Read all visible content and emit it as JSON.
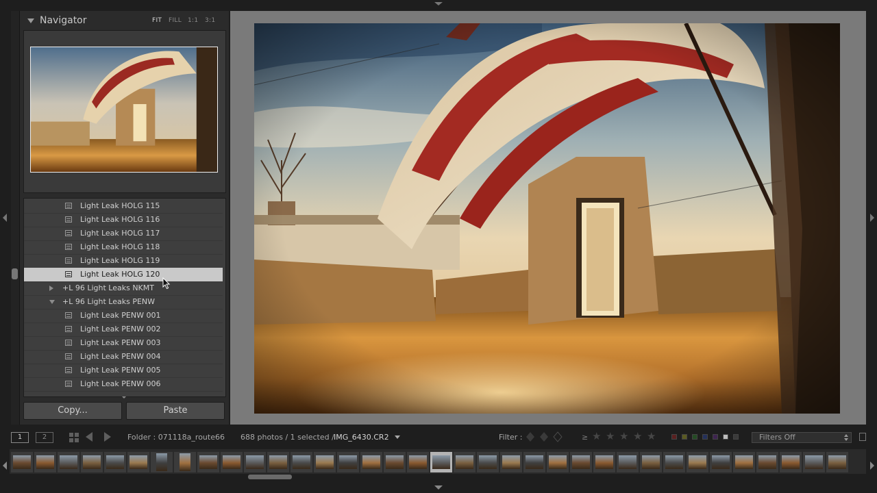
{
  "navigator": {
    "title": "Navigator",
    "zoom_options": [
      "FIT",
      "FILL",
      "1:1",
      "3:1"
    ],
    "active_zoom": "FIT"
  },
  "presets": {
    "items": [
      {
        "label": "Light Leak HOLG 115",
        "kind": "preset",
        "selected": false
      },
      {
        "label": "Light Leak HOLG 116",
        "kind": "preset",
        "selected": false
      },
      {
        "label": "Light Leak HOLG 117",
        "kind": "preset",
        "selected": false
      },
      {
        "label": "Light Leak HOLG 118",
        "kind": "preset",
        "selected": false
      },
      {
        "label": "Light Leak HOLG 119",
        "kind": "preset",
        "selected": false
      },
      {
        "label": "Light Leak HOLG 120",
        "kind": "preset",
        "selected": true
      },
      {
        "label": "+L 96 Light Leaks NKMT",
        "kind": "folder-collapsed",
        "selected": false
      },
      {
        "label": "+L 96 Light Leaks PENW",
        "kind": "folder-expanded",
        "selected": false
      },
      {
        "label": "Light Leak PENW 001",
        "kind": "preset",
        "selected": false
      },
      {
        "label": "Light Leak PENW 002",
        "kind": "preset",
        "selected": false
      },
      {
        "label": "Light Leak PENW 003",
        "kind": "preset",
        "selected": false
      },
      {
        "label": "Light Leak PENW 004",
        "kind": "preset",
        "selected": false
      },
      {
        "label": "Light Leak PENW 005",
        "kind": "preset",
        "selected": false
      },
      {
        "label": "Light Leak PENW 006",
        "kind": "preset",
        "selected": false
      }
    ]
  },
  "buttons": {
    "copy": "Copy...",
    "paste": "Paste"
  },
  "toolbar": {
    "view1": "1",
    "view2": "2",
    "folder": "Folder : 071118a_route66",
    "counts": "688 photos / 1 selected /",
    "filename": "IMG_6430.CR2",
    "filter_label": "Filter :",
    "rating_operator": "≥",
    "filters_dropdown": "Filters Off"
  },
  "colors": {
    "selected_row": "#c9c9c9",
    "main_background": "#7a7a7a",
    "label_red": "#7a2a2a",
    "label_yellow": "#6a6a2a",
    "label_green": "#2a5a2a",
    "label_blue": "#2a3a6a",
    "label_purple": "#4a2a5a"
  },
  "filmstrip": {
    "selected_index": 18,
    "thumbnail_count": 36
  }
}
